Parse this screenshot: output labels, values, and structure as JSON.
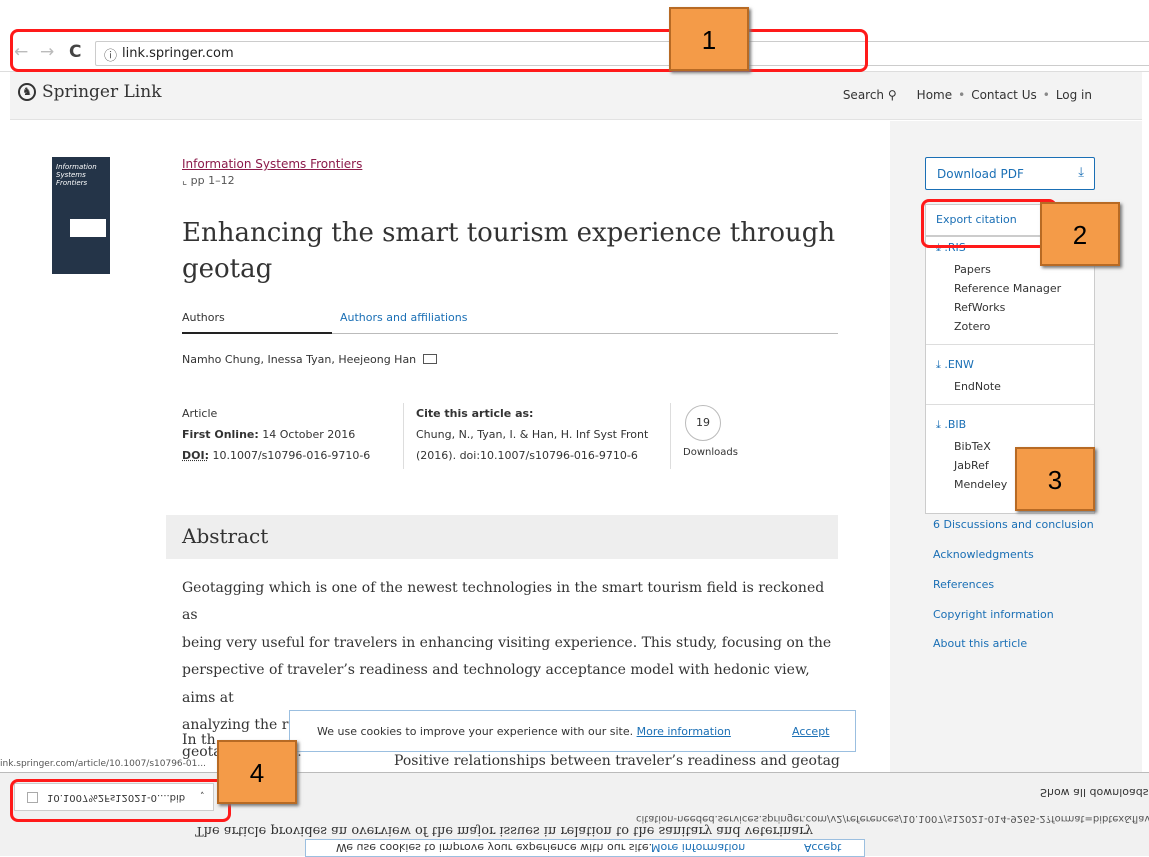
{
  "browser": {
    "url": "link.springer.com",
    "back": "←",
    "forward": "→",
    "reload": "C",
    "info": "ⓘ"
  },
  "header": {
    "logo": "Springer Link",
    "logo_icon": "springer-horse-icon",
    "nav": {
      "search": "Search",
      "home": "Home",
      "contact": "Contact Us",
      "login": "Log in"
    }
  },
  "article": {
    "cover_title": "Information Systems Frontiers",
    "journal": "Information Systems Frontiers",
    "pages": "pp 1–12",
    "title": "Enhancing the smart tourism experience through geotag",
    "tabs": [
      "Authors",
      "Authors and affiliations"
    ],
    "authors": "Namho Chung, Inessa Tyan, Heejeong Han",
    "type": "Article",
    "first_online_label": "First Online:",
    "first_online": "14 October 2016",
    "doi_label": "DOI:",
    "doi": "10.1007/s10796-016-9710-6",
    "cite_label": "Cite this article as:",
    "cite_line1": "Chung, N., Tyan, I. & Han, H. Inf Syst Front",
    "cite_line2": "(2016). doi:10.1007/s10796-016-9710-6",
    "downloads": "19",
    "downloads_label": "Downloads",
    "abstract_heading": "Abstract",
    "abstract_lines": [
      "Geotagging which is one of the newest technologies in the smart tourism field is reckoned as",
      "being very useful for travelers in enhancing visiting experience. This study, focusing on the",
      "perspective of traveler’s readiness and technology acceptance model with hedonic view, aims at",
      "analyzing the relationships between traveler’s readiness, geotag technology perception and",
      "geotag adoption."
    ],
    "abstract_more_start": "In th",
    "abstract_more_end": "Positive relationships between traveler’s readiness and geotag"
  },
  "sidebar": {
    "download_pdf": "Download PDF",
    "export_citation": "Export citation",
    "formats": [
      {
        "label": ".RIS",
        "tools": [
          "Papers",
          "Reference Manager",
          "RefWorks",
          "Zotero"
        ]
      },
      {
        "label": ".ENW",
        "tools": [
          "EndNote"
        ]
      },
      {
        "label": ".BIB",
        "tools": [
          "BibTeX",
          "JabRef",
          "Mendeley"
        ]
      }
    ],
    "toc": [
      "6 Discussions and conclusion",
      "Acknowledgments",
      "References",
      "Copyright information",
      "About this article"
    ]
  },
  "cookie": {
    "message": "We use cookies to improve your experience with our site.",
    "link": "More information",
    "accept": "Accept"
  },
  "shelf": {
    "status_left": "ink.springer.com/article/10.1007/s10796-01...",
    "file": "10.1007%2Fs12021-0....bib",
    "show_all": "Show all downloads",
    "status_url": "citation-needed.services.springer.com/v2/references/10.1007/s12021-014-9265-2?format=bibtex&flavour",
    "mirror_line": "The article provides an overview of the major issues in relation to the sanitary and veterinary",
    "mirror_cookie": "We use cookies to improve your experience with our site.",
    "mirror_more": "More information",
    "mirror_accept": "Accept"
  },
  "callouts": [
    "1",
    "2",
    "3",
    "4"
  ]
}
